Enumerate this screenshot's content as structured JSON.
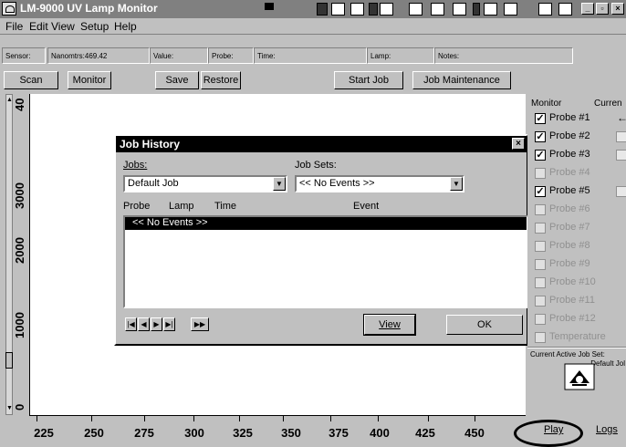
{
  "window": {
    "title": "LM-9000 UV Lamp Monitor"
  },
  "menu": [
    {
      "label": "File",
      "key": "F"
    },
    {
      "label": "Edit",
      "key": "E"
    },
    {
      "label": "View",
      "key": "V"
    },
    {
      "label": "Setup",
      "key": "S"
    },
    {
      "label": "Help",
      "key": "H"
    }
  ],
  "info_bar": {
    "sensor": "Sensor:",
    "nanometers": "Nanomtrs:469.42",
    "value": "Value:",
    "probe": "Probe:",
    "time": "Time:",
    "lamp": "Lamp:",
    "notes": "Notes:"
  },
  "toolbar": {
    "scan": "Scan",
    "monitor": "Monitor",
    "save": "Save",
    "restore": "Restore",
    "start_job": "Start Job",
    "job_maintenance": "Job Maintenance"
  },
  "plot": {
    "y_ticks": [
      "40",
      "3000",
      "2000",
      "1000",
      "0"
    ],
    "x_ticks": [
      "225",
      "250",
      "275",
      "300",
      "325",
      "350",
      "375",
      "400",
      "425",
      "450"
    ]
  },
  "dialog": {
    "title": "Job History",
    "close": "×",
    "jobs_label": "Jobs:",
    "jobs_value": "Default Job",
    "jobsets_label": "Job Sets:",
    "jobsets_value": "<< No Events >>",
    "columns": {
      "probe": "Probe",
      "lamp": "Lamp",
      "time": "Time",
      "event": "Event"
    },
    "rows": [
      "<< No Events >>"
    ],
    "view_button": "View",
    "ok_button": "OK"
  },
  "right_panel": {
    "monitor_header": "Monitor",
    "current_header": "Curren",
    "probes": [
      {
        "label": "Probe #1",
        "checked": true,
        "enabled": true,
        "current": "arrow"
      },
      {
        "label": "Probe #2",
        "checked": true,
        "enabled": true,
        "current": "box"
      },
      {
        "label": "Probe #3",
        "checked": true,
        "enabled": true,
        "current": "box"
      },
      {
        "label": "Probe #4",
        "checked": false,
        "enabled": false,
        "current": ""
      },
      {
        "label": "Probe #5",
        "checked": true,
        "enabled": true,
        "current": "box"
      },
      {
        "label": "Probe #6",
        "checked": false,
        "enabled": false,
        "current": ""
      },
      {
        "label": "Probe #7",
        "checked": false,
        "enabled": false,
        "current": ""
      },
      {
        "label": "Probe #8",
        "checked": false,
        "enabled": false,
        "current": ""
      },
      {
        "label": "Probe #9",
        "checked": false,
        "enabled": false,
        "current": ""
      },
      {
        "label": "Probe #10",
        "checked": false,
        "enabled": false,
        "current": ""
      },
      {
        "label": "Probe #11",
        "checked": false,
        "enabled": false,
        "current": ""
      },
      {
        "label": "Probe #12",
        "checked": false,
        "enabled": false,
        "current": ""
      },
      {
        "label": "Temperature",
        "checked": false,
        "enabled": false,
        "current": ""
      }
    ],
    "active_job_label": "Current Active Job Set:",
    "active_job_value": "Default Jol",
    "play": "Play",
    "logs": "Logs"
  }
}
